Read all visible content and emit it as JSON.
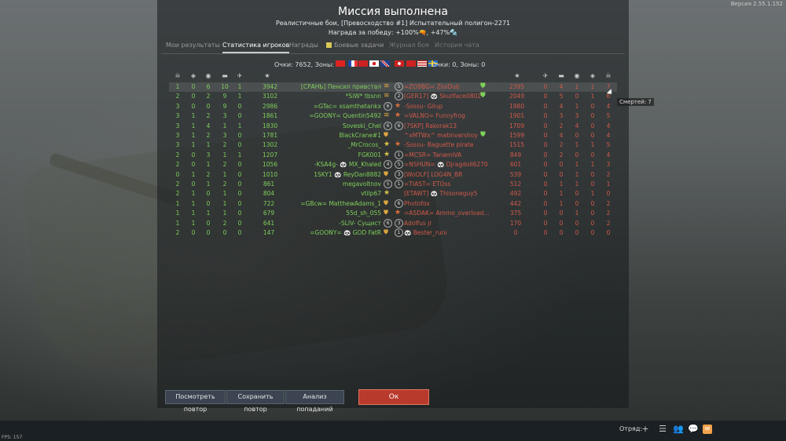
{
  "version": "Версия 2.55.1.152",
  "title": "Миссия выполнена",
  "subtitle": "Реалистичные бои, [Превосходство #1] Испытательный полигон-2271",
  "reward": "Награда за победу: +100%🔫, +47%🔩",
  "tabs": [
    "Мои результаты",
    "Статистика игроков",
    "Награды",
    "Боевые задачи",
    "Журнал боя",
    "История чата"
  ],
  "active_tab": "Статистика игроков",
  "score_left": "Очки: 7652, Зоны: 3",
  "score_right": "Очки: 0, Зоны: 0",
  "team_colors": {
    "allies": "#7fcf5a",
    "enemies": "#d05a4a",
    "accent": "#b83a2c"
  },
  "column_icons": [
    "skull-icon",
    "diamond-icon",
    "helmet-icon",
    "tank-icon",
    "plane-icon",
    "star-icon"
  ],
  "allies": [
    {
      "c": [
        "1",
        "0",
        "6",
        "10",
        "1"
      ],
      "score": "3942",
      "name": "[СРАНЬ] Пенсил привстал",
      "rank": "chevron"
    },
    {
      "c": [
        "2",
        "0",
        "2",
        "9",
        "1"
      ],
      "score": "3102",
      "name": "*SiW* tbsnn",
      "rank": "chevron"
    },
    {
      "c": [
        "3",
        "0",
        "0",
        "9",
        "0"
      ],
      "score": "2986",
      "name": "=GTac= xsamthetankx",
      "rank": "6"
    },
    {
      "c": [
        "3",
        "1",
        "2",
        "3",
        "0"
      ],
      "score": "1861",
      "name": "=GOONY= Quentin5492",
      "rank": "chevron"
    },
    {
      "c": [
        "3",
        "1",
        "4",
        "1",
        "1"
      ],
      "score": "1830",
      "name": "Soveski_Chel",
      "rank": "6"
    },
    {
      "c": [
        "3",
        "1",
        "2",
        "3",
        "0"
      ],
      "score": "1781",
      "name": "BlackCrane#1",
      "rank": "shield"
    },
    {
      "c": [
        "3",
        "1",
        "1",
        "2",
        "0"
      ],
      "score": "1302",
      "name": "_MrCrocos_",
      "rank": "star"
    },
    {
      "c": [
        "2",
        "0",
        "3",
        "1",
        "1"
      ],
      "score": "1207",
      "name": "FGK001",
      "rank": "star"
    },
    {
      "c": [
        "2",
        "0",
        "1",
        "2",
        "0"
      ],
      "score": "1056",
      "name": "-KSA4g- 🐼 MX_Khaled",
      "rank": "4"
    },
    {
      "c": [
        "0",
        "1",
        "2",
        "1",
        "0"
      ],
      "score": "1010",
      "name": "1SKY1 🐼 ReyDan8882",
      "rank": "shield"
    },
    {
      "c": [
        "2",
        "0",
        "1",
        "2",
        "0"
      ],
      "score": "861",
      "name": "megavoltnov",
      "rank": "5"
    },
    {
      "c": [
        "2",
        "1",
        "0",
        "1",
        "0"
      ],
      "score": "804",
      "name": "vtilp67",
      "rank": "star"
    },
    {
      "c": [
        "1",
        "1",
        "0",
        "1",
        "0"
      ],
      "score": "722",
      "name": "=GBcw= MatthewAdams_1",
      "rank": "shield"
    },
    {
      "c": [
        "1",
        "1",
        "1",
        "1",
        "0"
      ],
      "score": "679",
      "name": "55d_sh_055",
      "rank": "shield"
    },
    {
      "c": [
        "1",
        "1",
        "0",
        "2",
        "0"
      ],
      "score": "641",
      "name": "-SLIV- Сущист",
      "rank": "6"
    },
    {
      "c": [
        "2",
        "0",
        "0",
        "0",
        "0"
      ],
      "score": "147",
      "name": "=GOONY= 🐼 GOD FatR",
      "rank": "shield"
    }
  ],
  "enemies": [
    {
      "rank": "5",
      "name": "=ZO9BG= ZloiDub",
      "score": "2395",
      "c": [
        "0",
        "4",
        "1",
        "1",
        "7"
      ],
      "badge": true
    },
    {
      "rank": "2",
      "name": "[GER17] 🐼 Skullface0802",
      "score": "2049",
      "c": [
        "0",
        "5",
        "0",
        "1",
        "6"
      ],
      "badge": true
    },
    {
      "rank": "star",
      "name": "-Sossu- Gilup",
      "score": "1980",
      "c": [
        "0",
        "4",
        "1",
        "0",
        "4"
      ],
      "badge": false
    },
    {
      "rank": "star",
      "name": "=VALNO= Funnyfrog",
      "score": "1901",
      "c": [
        "0",
        "3",
        "3",
        "0",
        "5"
      ],
      "badge": false
    },
    {
      "rank": "6",
      "name": "[7SKP] Rakorak13",
      "score": "1709",
      "c": [
        "0",
        "2",
        "4",
        "0",
        "4"
      ],
      "badge": false
    },
    {
      "rank": "none",
      "name": "^xMTWx^ matinvarshoy",
      "score": "1599",
      "c": [
        "0",
        "4",
        "0",
        "0",
        "4"
      ],
      "badge": true
    },
    {
      "rank": "star",
      "name": "-Sossu- Baguette pirate",
      "score": "1515",
      "c": [
        "0",
        "2",
        "1",
        "1",
        "5"
      ],
      "badge": false
    },
    {
      "rank": "1",
      "name": "=MCSR= TanamiVA",
      "score": "849",
      "c": [
        "0",
        "2",
        "0",
        "0",
        "4"
      ],
      "badge": false
    },
    {
      "rank": "5",
      "name": "=NSHUN= 🐼 Djragdoll6270",
      "score": "601",
      "c": [
        "0",
        "0",
        "1",
        "1",
        "3"
      ],
      "badge": false
    },
    {
      "rank": "3",
      "name": "[WoOLF] LOG4N_BR",
      "score": "539",
      "c": [
        "0",
        "0",
        "1",
        "0",
        "2"
      ],
      "badge": false
    },
    {
      "rank": "1",
      "name": "=TIAST= ETOss",
      "score": "512",
      "c": [
        "0",
        "1",
        "1",
        "0",
        "1"
      ],
      "badge": false
    },
    {
      "rank": "none",
      "name": "[ETAWT] 🐼 Thisoneguy5",
      "score": "492",
      "c": [
        "0",
        "1",
        "0",
        "1",
        "0"
      ],
      "badge": false
    },
    {
      "rank": "6",
      "name": "Photofox",
      "score": "442",
      "c": [
        "0",
        "1",
        "0",
        "0",
        "2"
      ],
      "badge": false
    },
    {
      "rank": "star",
      "name": "=ASDAK= Ammo_overload...",
      "score": "375",
      "c": [
        "0",
        "0",
        "1",
        "0",
        "2"
      ],
      "badge": false
    },
    {
      "rank": "3",
      "name": "Adolfus jr",
      "score": "170",
      "c": [
        "0",
        "0",
        "0",
        "0",
        "2"
      ],
      "badge": false
    },
    {
      "rank": "1",
      "name": "🐼 Bester_runi",
      "score": "0",
      "c": [
        "0",
        "0",
        "0",
        "0",
        "0"
      ],
      "badge": false
    }
  ],
  "tooltip": "Смертей: 7",
  "buttons": {
    "replay": "Посмотреть повтор",
    "save": "Сохранить повтор",
    "hits": "Анализ попаданий",
    "ok": "Ок"
  },
  "fps": "FPS: 157",
  "squad_label": "Отряд:"
}
